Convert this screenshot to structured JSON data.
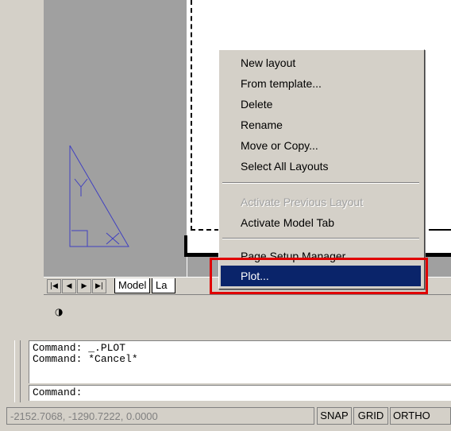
{
  "context_menu": {
    "items": [
      {
        "label": "New layout",
        "state": "enabled"
      },
      {
        "label": "From template...",
        "state": "enabled"
      },
      {
        "label": "Delete",
        "state": "enabled"
      },
      {
        "label": "Rename",
        "state": "enabled"
      },
      {
        "label": "Move or Copy...",
        "state": "enabled"
      },
      {
        "label": "Select All Layouts",
        "state": "enabled"
      },
      {
        "label": "Activate Previous Layout",
        "state": "disabled"
      },
      {
        "label": "Activate Model Tab",
        "state": "enabled"
      },
      {
        "label": "Page Setup Manager...",
        "state": "enabled"
      },
      {
        "label": "Plot...",
        "state": "highlighted"
      }
    ]
  },
  "tabs": {
    "model": "Model",
    "layout": "La"
  },
  "nav_buttons": {
    "first": "|◀",
    "prev": "◀",
    "next": "▶",
    "last": "▶|"
  },
  "command": {
    "history": [
      "Command:  _.PLOT",
      "Command:  *Cancel*"
    ],
    "prompt": "Command:"
  },
  "status": {
    "coordinates": "-2152.7068, -1290.7222, 0.0000",
    "snap": "SNAP",
    "grid": "GRID",
    "ortho": "ORTHO"
  },
  "icons": {
    "orbit": "◑",
    "ucs": "ucs-icon"
  },
  "colors": {
    "highlight": "#0a246a",
    "annotation_box": "#e00000",
    "background_gray": "#a0a0a0",
    "drawing_line": "#4040c0"
  }
}
